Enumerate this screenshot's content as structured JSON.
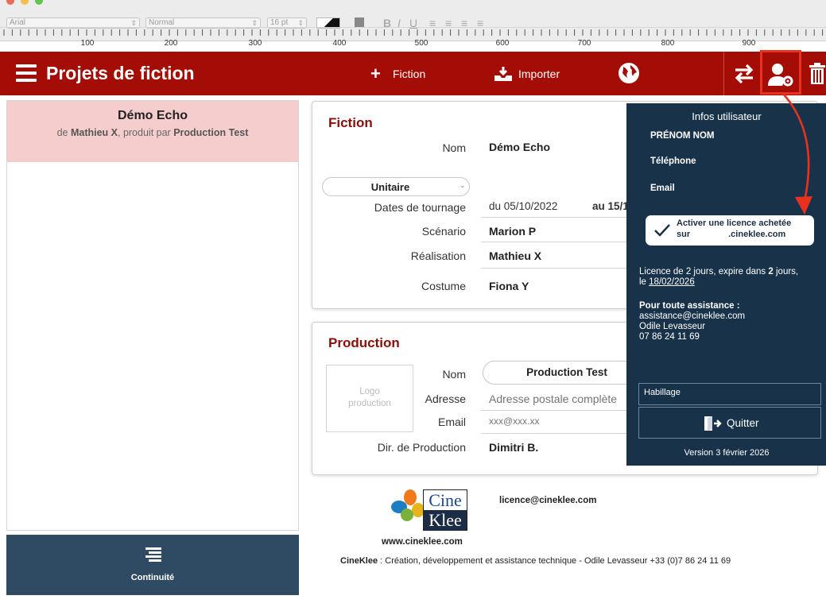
{
  "format_toolbar": {
    "font_name": "Arial",
    "font_style": "Normal",
    "font_size": "16 pt",
    "ruler_labels": [
      "100",
      "200",
      "300",
      "400",
      "500",
      "600",
      "700",
      "800",
      "900"
    ]
  },
  "appbar": {
    "title": "Projets de fiction",
    "fiction_button": "Fiction",
    "import_button": "Importer",
    "color": "#a40d06"
  },
  "project": {
    "name": "Démo Echo",
    "prefix": "de",
    "author": "Mathieu X",
    "middle": ", produit par",
    "producer": "Production Test"
  },
  "continuity": {
    "label": "Continuité"
  },
  "fiction_card": {
    "title": "Fiction",
    "name_label": "Nom",
    "name_value": "Démo Echo",
    "type_select": "Unitaire",
    "dates_label": "Dates de tournage",
    "date_from": "du 05/10/2022",
    "date_to": "au 15/1",
    "scenario_label": "Scénario",
    "scenario_value": "Marion P",
    "realisation_label": "Réalisation",
    "realisation_value": "Mathieu X",
    "costume_label": "Costume",
    "costume_value": "Fiona Y"
  },
  "production_card": {
    "title": "Production",
    "logo_placeholder_line1": "Logo",
    "logo_placeholder_line2": "production",
    "name_label": "Nom",
    "name_value": "Production Test",
    "address_label": "Adresse",
    "address_placeholder": "Adresse postale complète",
    "email_label": "Email",
    "email_placeholder": "xxx@xxx.xx",
    "director_label": "Dir. de Production",
    "director_value": "Dimitri B."
  },
  "user_popup": {
    "title": "Infos utilisateur",
    "name": "PRÉNOM NOM",
    "phone": "Téléphone",
    "email": "Email",
    "license_btn_line1": "Activer une licence achetée",
    "license_btn_line2_prefix": "sur",
    "license_btn_line2_suffix": ".cineklee.com",
    "license_info_prefix": "Licence de 2 jours, expire dans ",
    "license_days": "2",
    "license_info_suffix": " jours,",
    "license_info_le": "le ",
    "license_date": "18/02/2026",
    "support_title": "Pour toute assistance :",
    "support_email": "assistance@cineklee.com",
    "support_name": "Odile Levasseur",
    "support_phone": "07 86 24 11 69",
    "habillage_field": "Habillage",
    "quit_button": "Quitter",
    "version": "Version  3 février 2026",
    "bg_color": "#18324a"
  },
  "footer": {
    "logo_line1": "Cine",
    "logo_line2": "Klee",
    "licence_email": "licence@cineklee.com",
    "website": "www.cineklee.com",
    "credit_brand": "CineKlee",
    "credit_text": " : Création, développement et assistance technique - Odile Levasseur +33 (0)7 86 24 11 69"
  },
  "annotation_color": "#e8321f"
}
